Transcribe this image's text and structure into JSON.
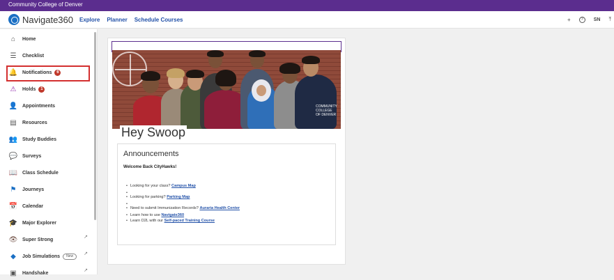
{
  "institution": "Community College of Denver",
  "brand": {
    "name": "Navigate360"
  },
  "topnav": {
    "explore": "Explore",
    "planner": "Planner",
    "schedule": "Schedule Courses"
  },
  "header_right": {
    "add": "+",
    "help": "?",
    "initials": "SN",
    "upload": "⤒"
  },
  "sidebar": {
    "items": [
      {
        "label": "Home",
        "icon": "⌂"
      },
      {
        "label": "Checklist",
        "icon": "☰"
      },
      {
        "label": "Notifications",
        "icon": "🔔",
        "badge": "6"
      },
      {
        "label": "Holds",
        "icon": "⚠",
        "badge": "1"
      },
      {
        "label": "Appointments",
        "icon": "👤"
      },
      {
        "label": "Resources",
        "icon": "▤"
      },
      {
        "label": "Study Buddies",
        "icon": "👥"
      },
      {
        "label": "Surveys",
        "icon": "💬"
      },
      {
        "label": "Class Schedule",
        "icon": "📖"
      },
      {
        "label": "Journeys",
        "icon": "⚑"
      },
      {
        "label": "Calendar",
        "icon": "📅"
      },
      {
        "label": "Major Explorer",
        "icon": "🎓"
      },
      {
        "label": "Super Strong",
        "icon": "👁"
      },
      {
        "label": "Job Simulations",
        "icon": "◆",
        "pill": "New"
      },
      {
        "label": "Handshake",
        "icon": "▣"
      }
    ]
  },
  "greeting": "Hey Swoop",
  "hero_logo": "COMMUNITY COLLEGE OF DENVER",
  "announcements": {
    "title": "Announcements",
    "welcome": "Welcome Back CityHawks!",
    "items": [
      {
        "text": "Looking for your class? ",
        "link": "Campus Map"
      },
      {
        "text": "Looking for parking? ",
        "link": "Parking Map"
      },
      {
        "text": "Need to submit Immunization Records? ",
        "link": "Auraria Health Center"
      },
      {
        "text": "Learn how to use ",
        "link": "Navigate360"
      },
      {
        "text": "Learn D2L with our ",
        "link": "Self-paced Training Course"
      }
    ]
  }
}
